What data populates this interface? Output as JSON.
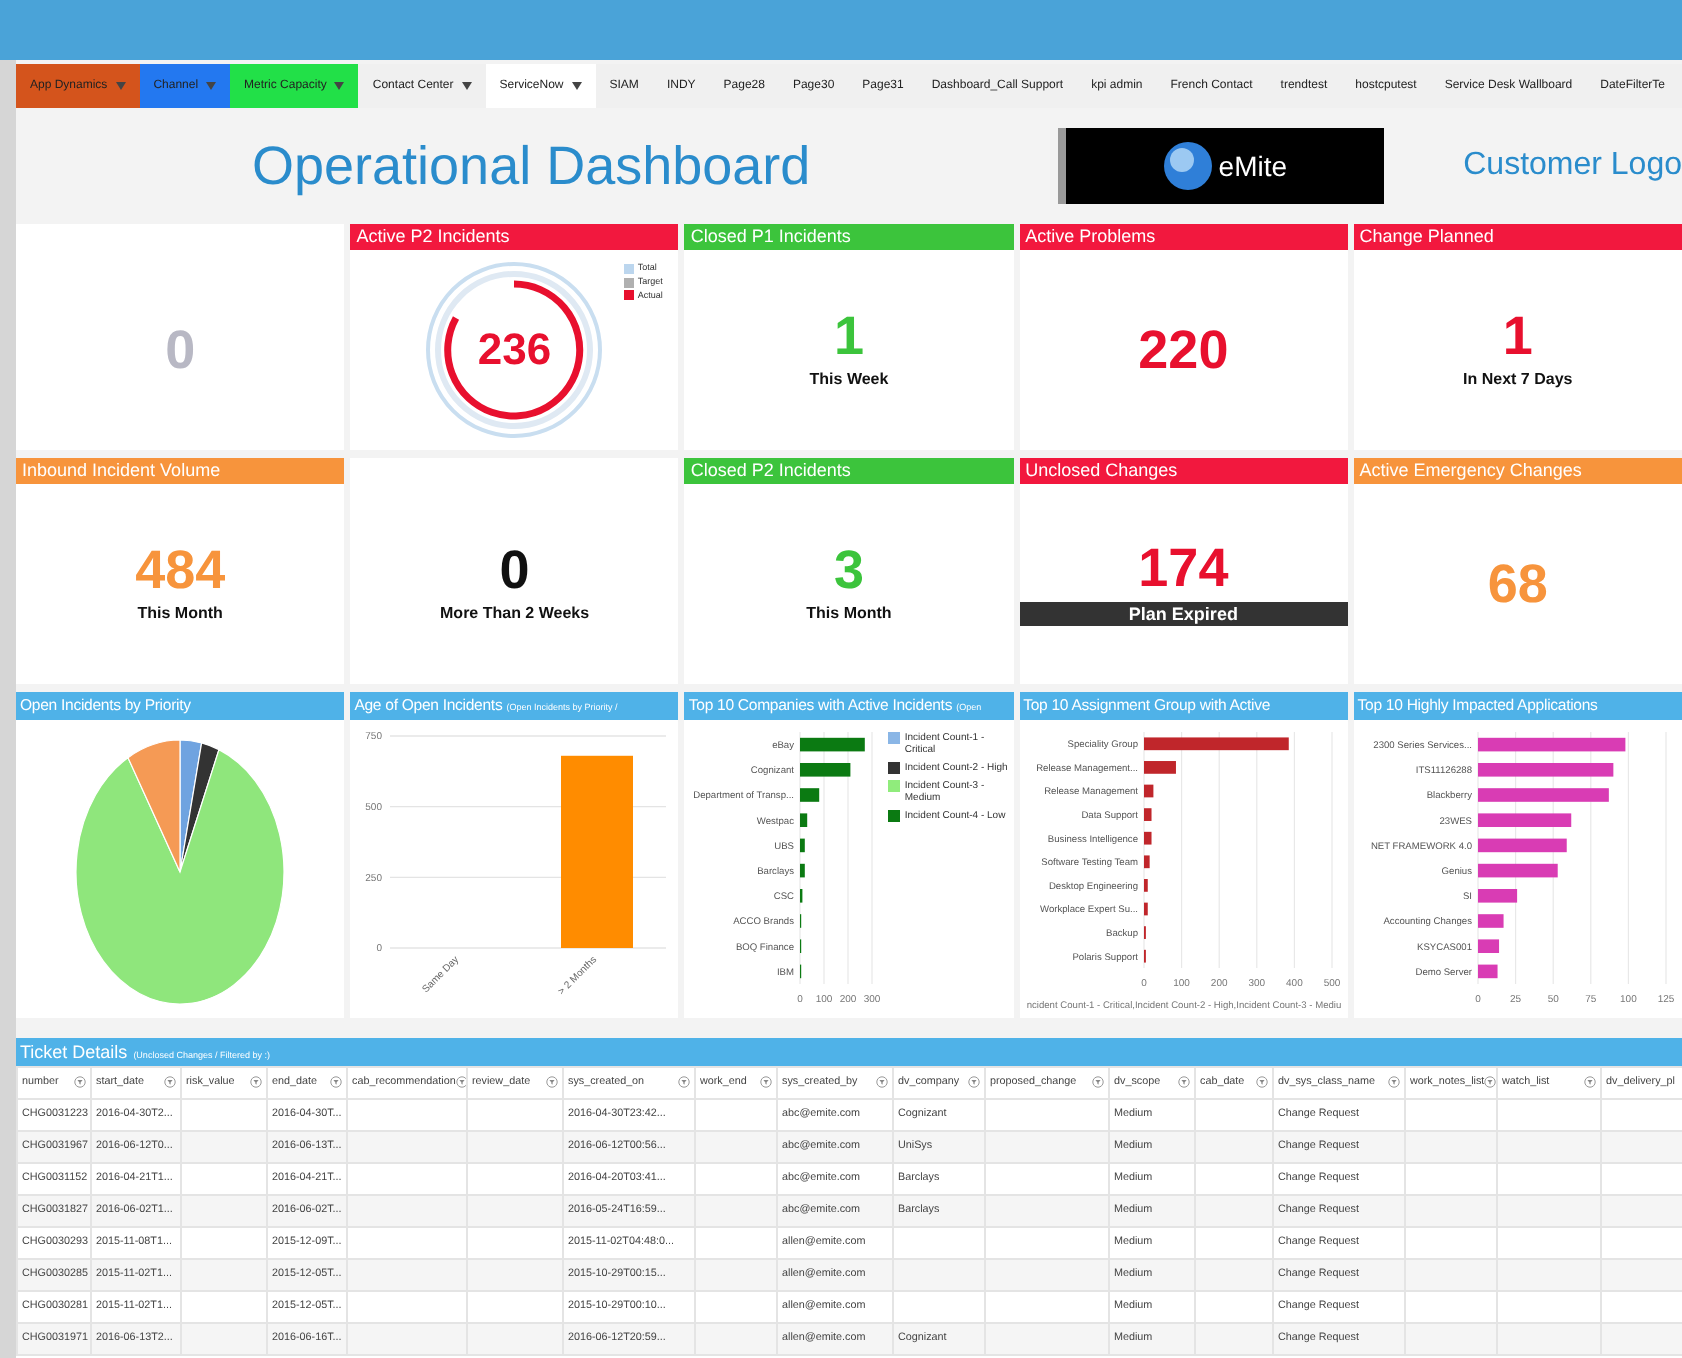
{
  "nav": [
    {
      "label": "App Dynamics",
      "color": "#d4541c",
      "dropdown": true,
      "selected": false
    },
    {
      "label": "Channel",
      "color": "#2378f0",
      "dropdown": true,
      "selected": false
    },
    {
      "label": "Metric Capacity",
      "color": "#22e048",
      "dropdown": true,
      "selected": false
    },
    {
      "label": "Contact Center",
      "dropdown": true,
      "selected": false
    },
    {
      "label": "ServiceNow",
      "dropdown": true,
      "selected": true
    },
    {
      "label": "SIAM",
      "dropdown": false,
      "selected": false
    },
    {
      "label": "INDY",
      "dropdown": false,
      "selected": false
    },
    {
      "label": "Page28",
      "dropdown": false,
      "selected": false
    },
    {
      "label": "Page30",
      "dropdown": false,
      "selected": false
    },
    {
      "label": "Page31",
      "dropdown": false,
      "selected": false
    },
    {
      "label": "Dashboard_Call Support",
      "dropdown": false,
      "selected": false
    },
    {
      "label": "kpi admin",
      "dropdown": false,
      "selected": false
    },
    {
      "label": "French Contact",
      "dropdown": false,
      "selected": false
    },
    {
      "label": "trendtest",
      "dropdown": false,
      "selected": false
    },
    {
      "label": "hostcputest",
      "dropdown": false,
      "selected": false
    },
    {
      "label": "Service Desk Wallboard",
      "dropdown": false,
      "selected": false
    },
    {
      "label": "DateFilterTe",
      "dropdown": false,
      "selected": false
    }
  ],
  "header": {
    "title": "Operational Dashboard",
    "logo_text": "eMite",
    "customer_logo": "Customer Logo"
  },
  "tiles": [
    {
      "kind": "number",
      "value": {
        "text": "0",
        "color": "#b8b8c4"
      }
    },
    {
      "kind": "gauge",
      "title": "Active P2 Incidents",
      "color": "#f2183e",
      "value": {
        "text": "236",
        "color": "#e8102e"
      },
      "legend": [
        {
          "label": "Total",
          "color": "#bcd6ee"
        },
        {
          "label": "Target",
          "color": "#b0b0b0"
        },
        {
          "label": "Actual",
          "color": "#e8102e"
        }
      ]
    },
    {
      "kind": "number",
      "title": "Closed P1 Incidents",
      "color": "#3cc43c",
      "value": {
        "text": "1",
        "color": "#3cc43c"
      },
      "caption": "This Week"
    },
    {
      "kind": "number",
      "title": "Active Problems",
      "color": "#f2183e",
      "value": {
        "text": "220",
        "color": "#e8102e"
      }
    },
    {
      "kind": "number",
      "title": "Change Planned",
      "color": "#f2183e",
      "value": {
        "text": "1",
        "color": "#e8102e"
      },
      "caption": "In Next 7 Days"
    },
    {
      "kind": "number",
      "title": "Inbound Incident Volume",
      "color": "#f7943c",
      "value": {
        "text": "484",
        "color": "#f7943c"
      },
      "caption": "This Month"
    },
    {
      "kind": "number",
      "value": {
        "text": "0",
        "color": "#111111"
      },
      "caption": "More Than 2 Weeks"
    },
    {
      "kind": "number",
      "title": "Closed P2 Incidents",
      "color": "#3cc43c",
      "value": {
        "text": "3",
        "color": "#3cc43c"
      },
      "caption": "This Month"
    },
    {
      "kind": "number",
      "title": "Unclosed Changes",
      "color": "#f2183e",
      "value": {
        "text": "174",
        "color": "#e8102e"
      },
      "banner": "Plan Expired"
    },
    {
      "kind": "number",
      "title": "Active Emergency Changes",
      "color": "#f7943c",
      "value": {
        "text": "68",
        "color": "#f7943c"
      }
    }
  ],
  "charts": [
    {
      "kind": "picture",
      "title": "Open Incidents by Priority"
    },
    {
      "kind": "chart",
      "title": "Age of Open Incidents",
      "subtitle": "(Open Incidents by Priority /",
      "chart_data": {
        "type": "bar",
        "categories": [
          "Same Day",
          "> 2 Months"
        ],
        "series": [
          {
            "color": "#ff8c00",
            "values": [
              0,
              680
            ]
          }
        ],
        "ylim": [
          0,
          750
        ],
        "yticks": [
          0,
          250,
          500,
          750
        ],
        "grid": true
      }
    },
    {
      "kind": "chart",
      "title": "Top 10 Companies with Active Incidents",
      "subtitle": "(Open",
      "chart_data": {
        "type": "bar",
        "orientation": "horizontal",
        "stacked": true,
        "categories": [
          "eBay",
          "Cognizant",
          "Department of Transp...",
          "Westpac",
          "UBS",
          "Barclays",
          "CSC",
          "ACCO Brands",
          "BOQ Finance",
          "IBM"
        ],
        "series": [
          {
            "name": "Incident Count-1 - Critical",
            "color": "#8ab6e6",
            "values": [
              0,
              0,
              0,
              0,
              0,
              0,
              0,
              0,
              0,
              0
            ]
          },
          {
            "name": "Incident Count-2 - High",
            "color": "#333333",
            "values": [
              0,
              0,
              0,
              0,
              0,
              0,
              0,
              0,
              0,
              0
            ]
          },
          {
            "name": "Incident Count-3 - Medium",
            "color": "#90ec7c",
            "values": [
              0,
              0,
              0,
              0,
              0,
              0,
              0,
              0,
              0,
              0
            ]
          },
          {
            "name": "Incident Count-4 - Low",
            "color": "#0b7a12",
            "values": [
              270,
              210,
              80,
              30,
              20,
              20,
              10,
              5,
              5,
              5
            ]
          }
        ],
        "xlim": [
          0,
          300
        ],
        "xticks": [
          0,
          100,
          200,
          300
        ],
        "grid": true
      }
    },
    {
      "kind": "chart",
      "title": "Top 10 Assignment Group with Active",
      "chart_data": {
        "type": "bar",
        "orientation": "horizontal",
        "categories": [
          "Speciality Group",
          "Release Management...",
          "Release Management",
          "Data Support",
          "Business Intelligence",
          "Software Testing Team",
          "Desktop Engineering",
          "Workplace Expert Su...",
          "Backup",
          "Polaris Support"
        ],
        "series": [
          {
            "color": "#c0262b",
            "values": [
              385,
              85,
              25,
              20,
              20,
              15,
              10,
              10,
              5,
              5
            ]
          }
        ],
        "xlim": [
          0,
          500
        ],
        "xticks": [
          0,
          100,
          200,
          300,
          400,
          500
        ],
        "xlabel": "ncident Count-1 - Critical,Incident Count-2 - High,Incident Count-3 - Mediu",
        "grid": true
      }
    },
    {
      "kind": "chart",
      "title": "Top 10 Highly Impacted Applications",
      "chart_data": {
        "type": "bar",
        "orientation": "horizontal",
        "categories": [
          "2300 Series Services...",
          "ITS11126288",
          "Blackberry",
          "23WES",
          "NET FRAMEWORK 4.0",
          "Genius",
          "SI",
          "Accounting Changes",
          "KSYCAS001",
          "Demo Server"
        ],
        "series": [
          {
            "color": "#d93cb4",
            "values": [
              98,
              90,
              87,
              62,
              59,
              53,
              26,
              17,
              14,
              13
            ]
          }
        ],
        "xlim": [
          0,
          125
        ],
        "xticks": [
          0,
          25,
          50,
          75,
          100,
          125
        ],
        "grid": true
      }
    }
  ],
  "table": {
    "title": "Ticket Details",
    "subtitle": "(Unclosed Changes / Filtered by :)",
    "columns": [
      "number",
      "start_date",
      "risk_value",
      "end_date",
      "cab_recommendation",
      "review_date",
      "sys_created_on",
      "work_end",
      "sys_created_by",
      "dv_company",
      "proposed_change",
      "dv_scope",
      "cab_date",
      "dv_sys_class_name",
      "work_notes_list",
      "watch_list",
      "dv_delivery_pl"
    ],
    "rows": [
      {
        "0": "CHG0031223",
        "1": "2016-04-30T2...",
        "3": "2016-04-30T...",
        "6": "2016-04-30T23:42...",
        "8": "abc@emite.com",
        "9": "Cognizant",
        "11": "Medium",
        "13": "Change Request"
      },
      {
        "0": "CHG0031967",
        "1": "2016-06-12T0...",
        "3": "2016-06-13T...",
        "6": "2016-06-12T00:56...",
        "8": "abc@emite.com",
        "9": "UniSys",
        "11": "Medium",
        "13": "Change Request"
      },
      {
        "0": "CHG0031152",
        "1": "2016-04-21T1...",
        "3": "2016-04-21T...",
        "6": "2016-04-20T03:41...",
        "8": "abc@emite.com",
        "9": "Barclays",
        "11": "Medium",
        "13": "Change Request"
      },
      {
        "0": "CHG0031827",
        "1": "2016-06-02T1...",
        "3": "2016-06-02T...",
        "6": "2016-05-24T16:59...",
        "8": "abc@emite.com",
        "9": "Barclays",
        "11": "Medium",
        "13": "Change Request"
      },
      {
        "0": "CHG0030293",
        "1": "2015-11-08T1...",
        "3": "2015-12-09T...",
        "6": "2015-11-02T04:48:0...",
        "8": "allen@emite.com",
        "11": "Medium",
        "13": "Change Request"
      },
      {
        "0": "CHG0030285",
        "1": "2015-11-02T1...",
        "3": "2015-12-05T...",
        "6": "2015-10-29T00:15...",
        "8": "allen@emite.com",
        "11": "Medium",
        "13": "Change Request"
      },
      {
        "0": "CHG0030281",
        "1": "2015-11-02T1...",
        "3": "2015-12-05T...",
        "6": "2015-10-29T00:10...",
        "8": "allen@emite.com",
        "11": "Medium",
        "13": "Change Request"
      },
      {
        "0": "CHG0031971",
        "1": "2016-06-13T2...",
        "3": "2016-06-16T...",
        "6": "2016-06-12T20:59...",
        "8": "allen@emite.com",
        "9": "Cognizant",
        "11": "Medium",
        "13": "Change Request"
      }
    ]
  }
}
